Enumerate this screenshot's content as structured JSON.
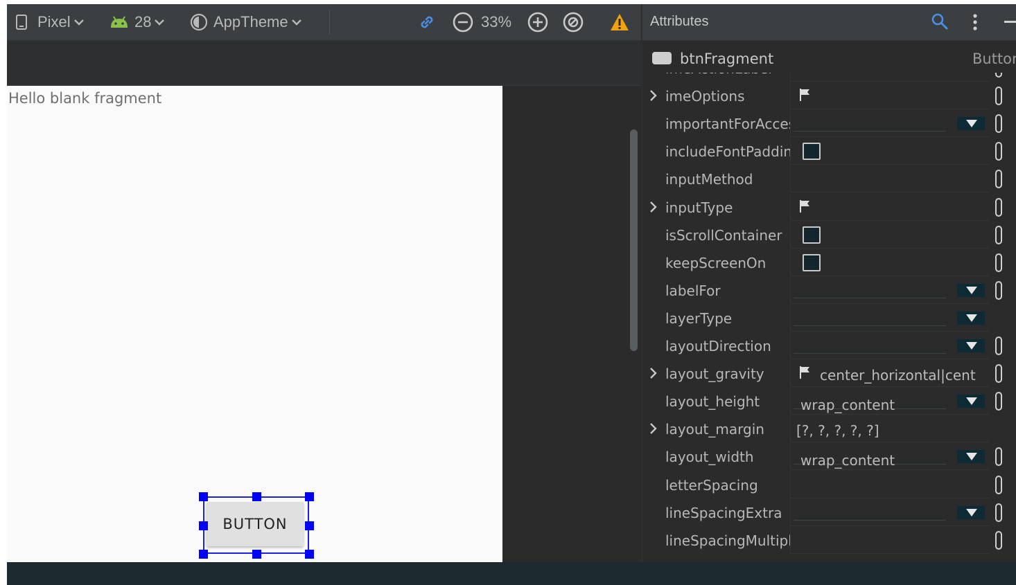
{
  "toolbar": {
    "device_label": "Pixel",
    "api_level": "28",
    "theme_label": "AppTheme",
    "zoom_level": "33%"
  },
  "canvas": {
    "hello_text": "Hello blank fragment",
    "button_text": "BUTTON"
  },
  "attributes": {
    "panel_title": "Attributes",
    "component_name": "btnFragment",
    "component_type": "Button",
    "rows": [
      {
        "name": "imeActionLabel",
        "expandable": false,
        "value_type": "text",
        "value": "",
        "reset": true
      },
      {
        "name": "imeOptions",
        "expandable": true,
        "value_type": "flag",
        "value": "",
        "reset": true
      },
      {
        "name": "importantForAccessibility",
        "expandable": false,
        "value_type": "dropdown",
        "value": "",
        "reset": true
      },
      {
        "name": "includeFontPadding",
        "expandable": false,
        "value_type": "checkbox",
        "value": "",
        "reset": true
      },
      {
        "name": "inputMethod",
        "expandable": false,
        "value_type": "text",
        "value": "",
        "reset": true
      },
      {
        "name": "inputType",
        "expandable": true,
        "value_type": "flag",
        "value": "",
        "reset": true
      },
      {
        "name": "isScrollContainer",
        "expandable": false,
        "value_type": "checkbox",
        "value": "",
        "reset": true
      },
      {
        "name": "keepScreenOn",
        "expandable": false,
        "value_type": "checkbox",
        "value": "",
        "reset": true
      },
      {
        "name": "labelFor",
        "expandable": false,
        "value_type": "dropdown",
        "value": "",
        "reset": true
      },
      {
        "name": "layerType",
        "expandable": false,
        "value_type": "dropdown",
        "value": "",
        "reset": false
      },
      {
        "name": "layoutDirection",
        "expandable": false,
        "value_type": "dropdown",
        "value": "",
        "reset": true
      },
      {
        "name": "layout_gravity",
        "expandable": true,
        "value_type": "flag",
        "value": "center_horizontal|cent",
        "reset": true
      },
      {
        "name": "layout_height",
        "expandable": false,
        "value_type": "dropdown",
        "value": "wrap_content",
        "reset": true
      },
      {
        "name": "layout_margin",
        "expandable": true,
        "value_type": "text",
        "value": "[?, ?, ?, ?, ?]",
        "reset": false
      },
      {
        "name": "layout_width",
        "expandable": false,
        "value_type": "dropdown",
        "value": "wrap_content",
        "reset": true
      },
      {
        "name": "letterSpacing",
        "expandable": false,
        "value_type": "text",
        "value": "",
        "reset": true
      },
      {
        "name": "lineSpacingExtra",
        "expandable": false,
        "value_type": "dropdown",
        "value": "",
        "reset": true
      },
      {
        "name": "lineSpacingMultiplier",
        "expandable": false,
        "value_type": "text",
        "value": "",
        "reset": true
      }
    ]
  },
  "colors": {
    "toolbar_bg": "#3c3f41",
    "panel_bg": "#2b2b2b",
    "link_blue": "#4a8fe7",
    "warning": "#f0a30a",
    "selection": "#0000ff",
    "api_green": "#8bc34a"
  }
}
